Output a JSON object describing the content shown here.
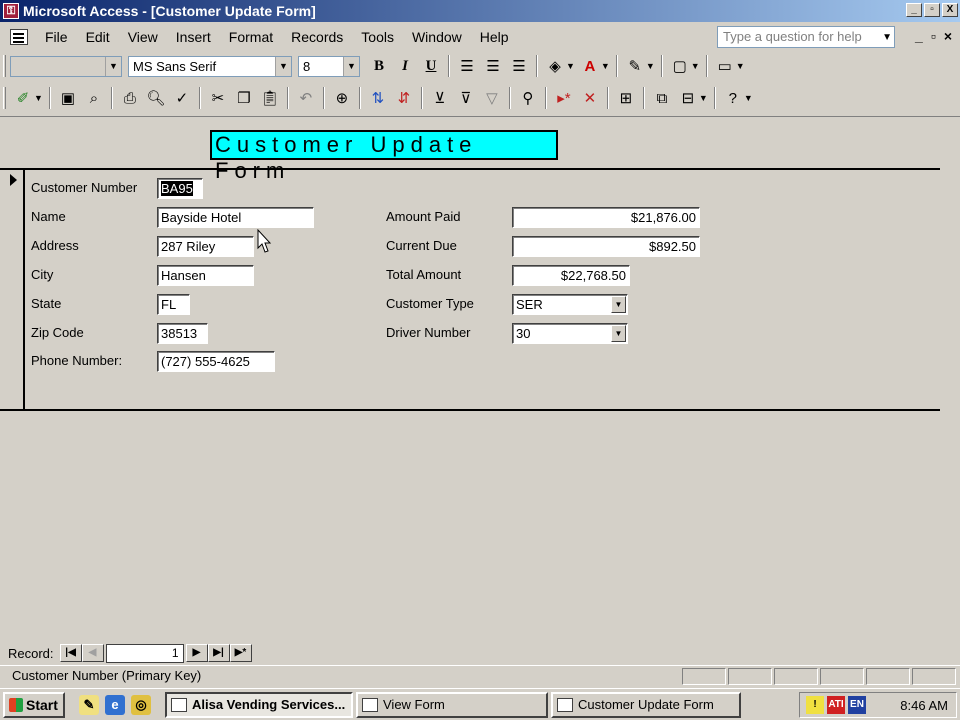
{
  "window": {
    "title": "Microsoft Access - [Customer Update Form]",
    "controls": [
      "_",
      "▫",
      "X"
    ]
  },
  "menu": {
    "items": [
      "File",
      "Edit",
      "View",
      "Insert",
      "Format",
      "Records",
      "Tools",
      "Window",
      "Help"
    ],
    "help_placeholder": "Type a question for help"
  },
  "formatting": {
    "object_combo": "",
    "font_name": "MS Sans Serif",
    "font_size": "8",
    "bold": "B",
    "italic": "I",
    "underline": "U"
  },
  "form": {
    "title": "Customer Update Form",
    "fields": {
      "customer_number": {
        "label": "Customer Number",
        "value": "BA95"
      },
      "name": {
        "label": "Name",
        "value": "Bayside Hotel"
      },
      "address": {
        "label": "Address",
        "value": "287 Riley"
      },
      "city": {
        "label": "City",
        "value": "Hansen"
      },
      "state": {
        "label": "State",
        "value": "FL"
      },
      "zip": {
        "label": "Zip Code",
        "value": "38513"
      },
      "phone": {
        "label": "Phone Number:",
        "value": "(727) 555-4625"
      },
      "amount_paid": {
        "label": "Amount Paid",
        "value": "$21,876.00"
      },
      "current_due": {
        "label": "Current Due",
        "value": "$892.50"
      },
      "total_amount": {
        "label": "Total Amount",
        "value": "$22,768.50"
      },
      "customer_type": {
        "label": "Customer Type",
        "value": "SER"
      },
      "driver_number": {
        "label": "Driver Number",
        "value": "30"
      }
    }
  },
  "navigation": {
    "label": "Record:",
    "current": "1"
  },
  "status": {
    "text": "Customer Number (Primary Key)"
  },
  "taskbar": {
    "start": "Start",
    "tasks": [
      "Alisa Vending Services...",
      "View Form",
      "Customer Update Form"
    ],
    "clock": "8:46 AM",
    "lang": "EN"
  },
  "colors": {
    "title_gradient_start": "#0a246a",
    "form_title_bg": "#00ffff",
    "chrome": "#d4d0c8"
  }
}
